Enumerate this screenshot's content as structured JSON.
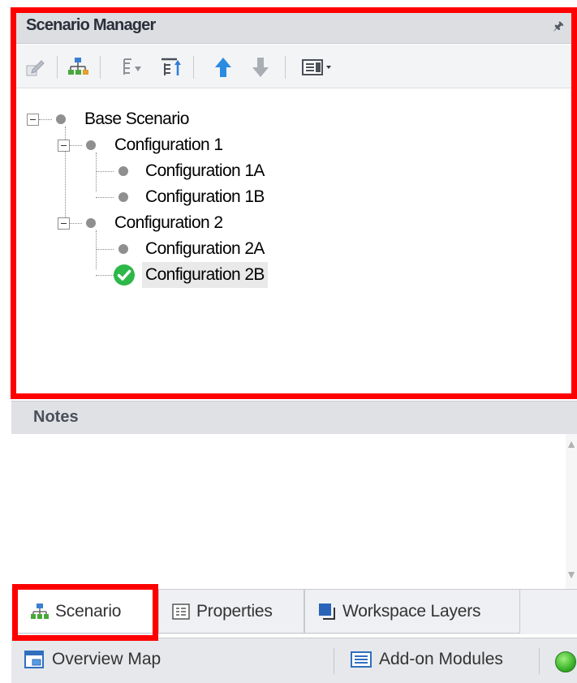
{
  "scenario_manager": {
    "title": "Scenario Manager",
    "pin_glyph": "ᅠ",
    "toolbar_icons": [
      "edit-scenario-icon",
      "new-child-scenario-icon",
      "sort-icon",
      "filter-icon",
      "move-up-icon",
      "move-down-icon",
      "view-options-icon"
    ],
    "tree": [
      {
        "label": "Base Scenario",
        "level": 0,
        "active": false
      },
      {
        "label": "Configuration 1",
        "level": 1,
        "active": false
      },
      {
        "label": "Configuration 1A",
        "level": 2,
        "active": false
      },
      {
        "label": "Configuration 1B",
        "level": 2,
        "active": false
      },
      {
        "label": "Configuration 2",
        "level": 1,
        "active": false
      },
      {
        "label": "Configuration 2A",
        "level": 2,
        "active": false
      },
      {
        "label": "Configuration 2B",
        "level": 2,
        "active": true
      }
    ]
  },
  "notes": {
    "title": "Notes",
    "content": ""
  },
  "tabs": [
    {
      "label": "Scenario",
      "icon": "scenario-tree-icon",
      "selected": true
    },
    {
      "label": "Properties",
      "icon": "properties-icon",
      "selected": false
    },
    {
      "label": "Workspace Layers",
      "icon": "workspace-layers-icon",
      "selected": false
    }
  ],
  "statusbar": {
    "overview_map": "Overview Map",
    "addon_modules": "Add-on Modules",
    "status_light": "green-status-light"
  },
  "colors": {
    "highlight": "#ff0000",
    "active_check": "#2db84a",
    "panel_header": "#dcdee2"
  }
}
